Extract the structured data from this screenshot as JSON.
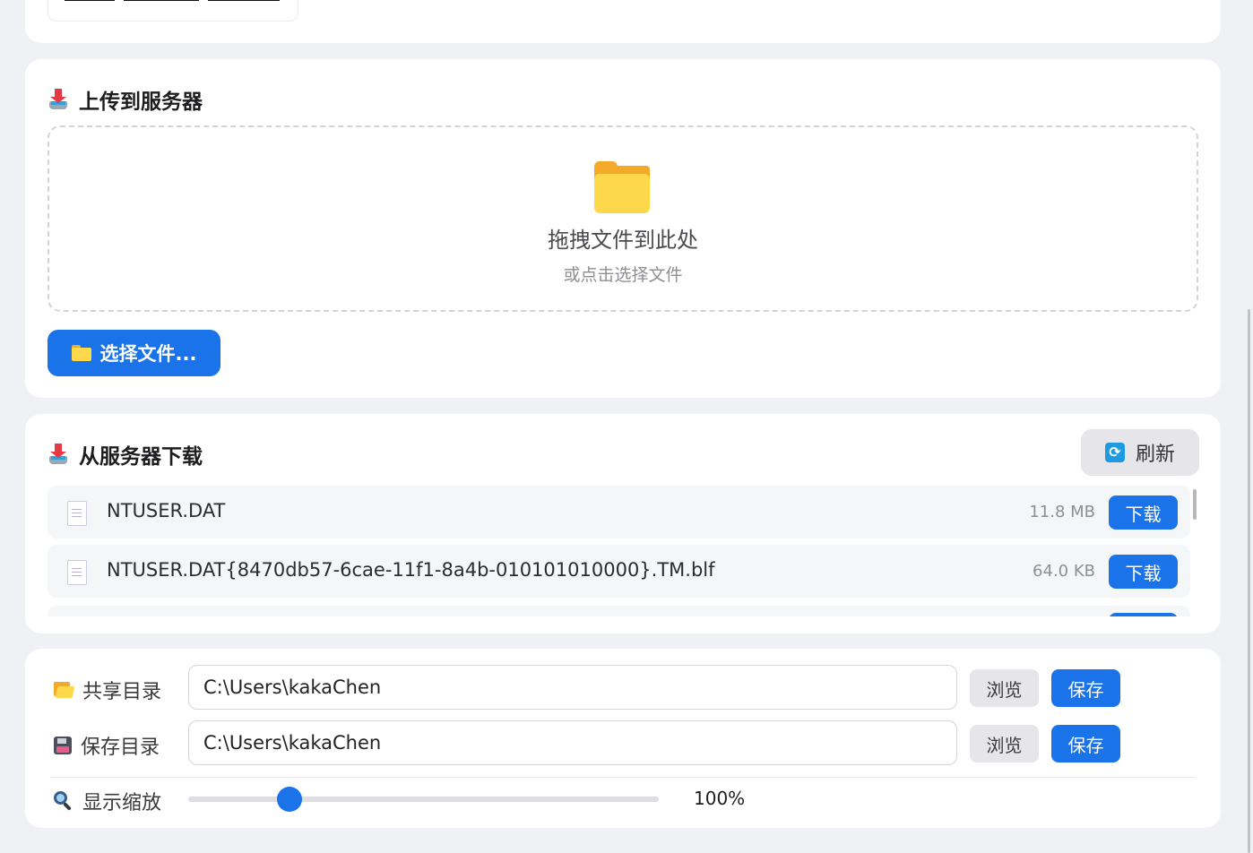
{
  "upload": {
    "title": "上传到服务器",
    "dropzone_main": "拖拽文件到此处",
    "dropzone_sub": "或点击选择文件",
    "choose_button": "选择文件..."
  },
  "download": {
    "title": "从服务器下载",
    "refresh_button": "刷新",
    "files": [
      {
        "name": "NTUSER.DAT",
        "size": "11.8 MB",
        "action": "下载"
      },
      {
        "name": "NTUSER.DAT{8470db57-6cae-11f1-8a4b-010101010000}.TM.blf",
        "size": "64.0 KB",
        "action": "下载"
      }
    ]
  },
  "settings": {
    "share_dir": {
      "label": "共享目录",
      "value": "C:\\Users\\kakaChen",
      "browse": "浏览",
      "save": "保存"
    },
    "save_dir": {
      "label": "保存目录",
      "value": "C:\\Users\\kakaChen",
      "browse": "浏览",
      "save": "保存"
    },
    "zoom": {
      "label": "显示缩放",
      "value_text": "100%",
      "slider_fraction": 0.215
    }
  },
  "colors": {
    "accent": "#1a73e8",
    "page_bg": "#f0f1f5"
  },
  "icons": {
    "section": "inbox-tray-icon",
    "folder": "folder-icon",
    "refresh": "refresh-icon",
    "file": "document-icon",
    "share": "open-folder-icon",
    "save": "floppy-disk-icon",
    "zoom": "magnifier-icon"
  }
}
